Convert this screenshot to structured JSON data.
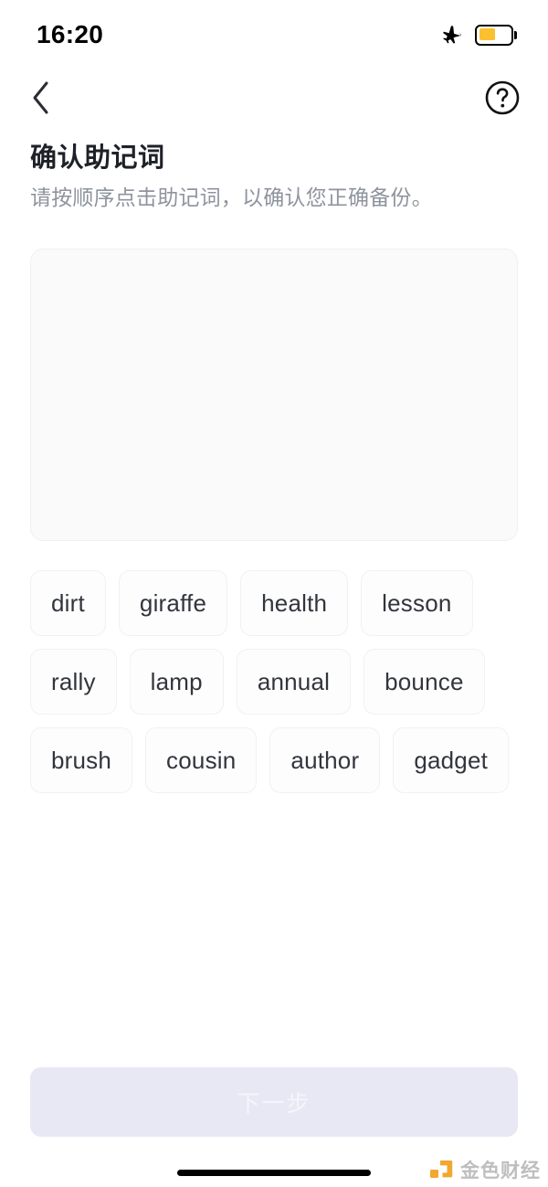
{
  "status_bar": {
    "time": "16:20",
    "airplane_icon": "airplane-icon",
    "battery_icon": "battery-icon",
    "battery_level_percent": 45,
    "battery_color": "#fbc02d"
  },
  "nav": {
    "back_icon": "chevron-left-icon",
    "help_icon": "question-circle-icon"
  },
  "header": {
    "title": "确认助记词",
    "subtitle": "请按顺序点击助记词，以确认您正确备份。"
  },
  "answer_area": {
    "selected_words": [],
    "background_color": "#fafafa"
  },
  "word_pool": {
    "words": [
      "dirt",
      "giraffe",
      "health",
      "lesson",
      "rally",
      "lamp",
      "annual",
      "bounce",
      "brush",
      "cousin",
      "author",
      "gadget"
    ]
  },
  "footer": {
    "next_label": "下一步",
    "next_enabled": false,
    "next_background_color": "#e8e8f5"
  },
  "watermark": {
    "text": "金色财经",
    "logo_icon": "jinse-logo-icon",
    "logo_color": "#f0a020"
  }
}
